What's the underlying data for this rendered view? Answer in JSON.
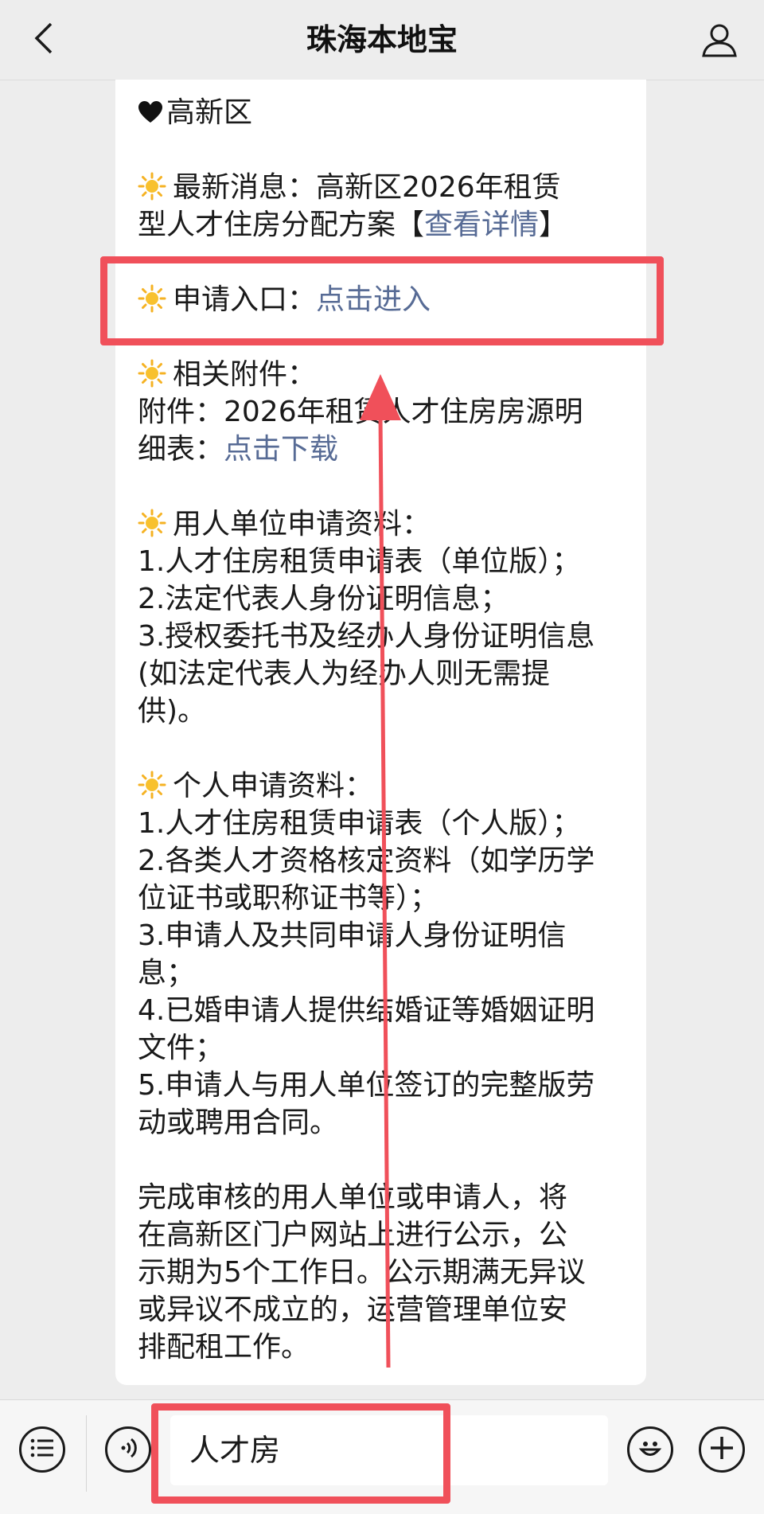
{
  "header": {
    "title": "珠海本地宝",
    "back_icon": "chevron-left-icon",
    "profile_icon": "user-icon"
  },
  "article": {
    "district": "高新区",
    "news_label": "最新消息：",
    "news_text_1": "高新区2026年租赁",
    "news_text_2": "型人才住房分配方案【",
    "news_link": "查看详情",
    "news_close": "】",
    "entry_label": "申请入口：",
    "entry_link": "点击进入",
    "attach_label": "相关附件：",
    "attach_line1": "附件：2026年租赁人才住房房源明",
    "attach_line2_prefix": "细表：",
    "attach_link": "点击下载",
    "employer_heading": "用人单位申请资料：",
    "employer_items": [
      "1.人才住房租赁申请表（单位版）；",
      "2.法定代表人身份证明信息；",
      "3.授权委托书及经办人身份证明信息",
      "(如法定代表人为经办人则无需提",
      "供)。"
    ],
    "personal_heading": "个人申请资料：",
    "personal_items": [
      "1.人才住房租赁申请表（个人版）；",
      "2.各类人才资格核定资料（如学历学",
      "位证书或职称证书等）；",
      "3.申请人及共同申请人身份证明信",
      "息；",
      "4.已婚申请人提供结婚证等婚姻证明",
      "文件；",
      "5.申请人与用人单位签订的完整版劳",
      "动或聘用合同。"
    ],
    "notice_lines": [
      "完成审核的用人单位或申请人，将",
      "在高新区门户网站上进行公示，公",
      "示期为5个工作日。公示期满无异议",
      "或异议不成立的，运营管理单位安",
      "排配租工作。"
    ]
  },
  "bottom_bar": {
    "menu_icon": "menu-list-icon",
    "voice_icon": "voice-icon",
    "input_value": "人才房",
    "emoji_icon": "emoji-icon",
    "plus_icon": "plus-icon"
  },
  "colors": {
    "link": "#576b95",
    "annotation": "#f0505a",
    "sun": "#f5b223"
  }
}
